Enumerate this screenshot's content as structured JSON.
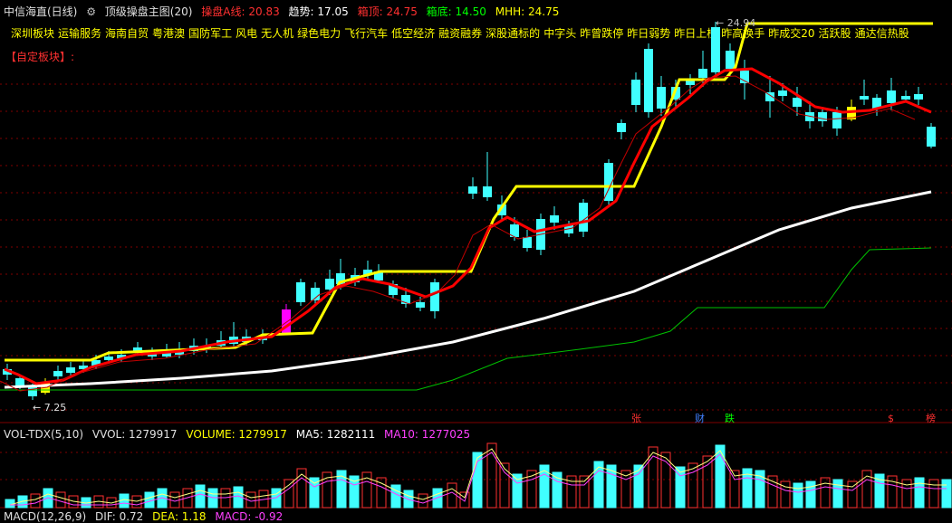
{
  "header": {
    "stock_title": "中信海直(日线)",
    "indicator_title": "顶级操盘主图(20)",
    "items": [
      {
        "label": "操盘A线:",
        "value": "20.83",
        "color": "#ff3030"
      },
      {
        "label": "趋势:",
        "value": "17.05",
        "color": "#ffffff"
      },
      {
        "label": "箱顶:",
        "value": "24.75",
        "color": "#ff3030"
      },
      {
        "label": "箱底:",
        "value": "14.50",
        "color": "#00ff00"
      },
      {
        "label": "MHH:",
        "value": "24.75",
        "color": "#ffff00"
      }
    ]
  },
  "tags": [
    "深圳板块",
    "运输服务",
    "海南自贸",
    "粤港澳",
    "国防军工",
    "风电",
    "无人机",
    "绿色电力",
    "飞行汽车",
    "低空经济",
    "融资融券",
    "深股通标的",
    "中字头",
    "昨曾跌停",
    "昨日弱势",
    "昨日上榜",
    "昨高换手",
    "昨成交20",
    "活跃股",
    "通达信热股"
  ],
  "custom_block": "【自定板块】:",
  "price_labels": {
    "low": "7.25",
    "high": "24.94"
  },
  "event_markers": [
    {
      "text": "张",
      "color": "#ff3030"
    },
    {
      "text": "财",
      "color": "#4080ff"
    },
    {
      "text": "跌",
      "color": "#00ff00"
    },
    {
      "text": "$",
      "color": "#ff3030"
    },
    {
      "text": "榜",
      "color": "#ff3030"
    }
  ],
  "volume": {
    "name": "VOL-TDX(5,10)",
    "vvol": "VVOL: 1279917",
    "volume": "VOLUME: 1279917",
    "ma5": "MA5: 1282111",
    "ma10": "MA10: 1277025"
  },
  "macd": {
    "name": "MACD(12,26,9)",
    "dif": "DIF: 0.72",
    "dea": "DEA: 1.18",
    "macd": "MACD: -0.92"
  },
  "colors": {
    "up": "#ff00ff",
    "down": "#40ffff",
    "red_line": "#ff0000",
    "yellow_line": "#ffff00",
    "white_line": "#ffffff",
    "green_line": "#00c000",
    "grid": "#800000"
  }
}
